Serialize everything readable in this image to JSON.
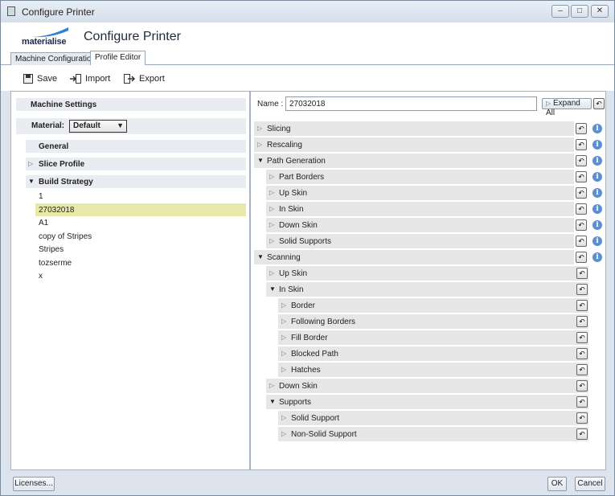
{
  "window": {
    "title": "Configure Printer"
  },
  "header": {
    "logo_text": "materialise",
    "heading": "Configure Printer"
  },
  "tabs": [
    {
      "label": "Machine Configuration",
      "active": false
    },
    {
      "label": "Profile Editor",
      "active": true
    }
  ],
  "toolbar": {
    "save": "Save",
    "import": "Import",
    "export": "Export"
  },
  "left": {
    "machine_settings": "Machine Settings",
    "material_label": "Material:",
    "material_value": "Default",
    "general": "General",
    "slice_profile": "Slice Profile",
    "build_strategy": "Build Strategy",
    "build_items": [
      "1",
      "27032018",
      "A1",
      "copy of Stripes",
      "Stripes",
      "tozserme",
      "x"
    ],
    "selected_index": 1
  },
  "right": {
    "name_label": "Name :",
    "name_value": "27032018",
    "expand_all": "Expand All",
    "tree": [
      {
        "label": "Slicing",
        "depth": 0,
        "expanded": false,
        "info": true
      },
      {
        "label": "Rescaling",
        "depth": 0,
        "expanded": false,
        "info": true
      },
      {
        "label": "Path Generation",
        "depth": 0,
        "expanded": true,
        "info": true
      },
      {
        "label": "Part Borders",
        "depth": 1,
        "expanded": false,
        "info": true
      },
      {
        "label": "Up Skin",
        "depth": 1,
        "expanded": false,
        "info": true
      },
      {
        "label": "In Skin",
        "depth": 1,
        "expanded": false,
        "info": true
      },
      {
        "label": "Down Skin",
        "depth": 1,
        "expanded": false,
        "info": true
      },
      {
        "label": "Solid Supports",
        "depth": 1,
        "expanded": false,
        "info": true
      },
      {
        "label": "Scanning",
        "depth": 0,
        "expanded": true,
        "info": true
      },
      {
        "label": "Up Skin",
        "depth": 1,
        "expanded": false,
        "info": false
      },
      {
        "label": "In Skin",
        "depth": 1,
        "expanded": true,
        "info": false
      },
      {
        "label": "Border",
        "depth": 2,
        "expanded": false,
        "info": false
      },
      {
        "label": "Following Borders",
        "depth": 2,
        "expanded": false,
        "info": false
      },
      {
        "label": "Fill Border",
        "depth": 2,
        "expanded": false,
        "info": false
      },
      {
        "label": "Blocked Path",
        "depth": 2,
        "expanded": false,
        "info": false
      },
      {
        "label": "Hatches",
        "depth": 2,
        "expanded": false,
        "info": false
      },
      {
        "label": "Down Skin",
        "depth": 1,
        "expanded": false,
        "info": false
      },
      {
        "label": "Supports",
        "depth": 1,
        "expanded": true,
        "info": false
      },
      {
        "label": "Solid Support",
        "depth": 2,
        "expanded": false,
        "info": false
      },
      {
        "label": "Non-Solid Support",
        "depth": 2,
        "expanded": false,
        "info": false
      }
    ]
  },
  "footer": {
    "licenses": "Licenses...",
    "ok": "OK",
    "cancel": "Cancel"
  }
}
